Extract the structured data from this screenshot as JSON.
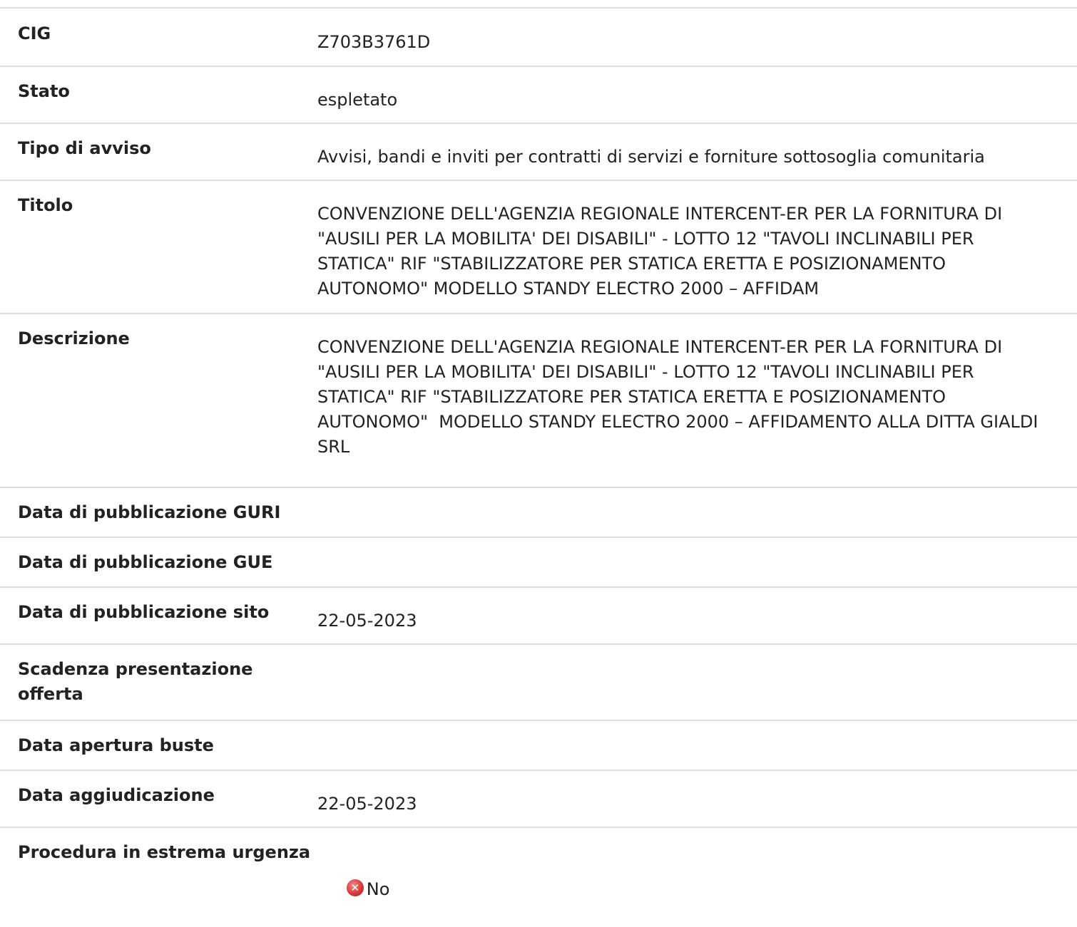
{
  "fields": {
    "cig": {
      "label": "CIG",
      "value": "Z703B3761D"
    },
    "stato": {
      "label": "Stato",
      "value": "espletato"
    },
    "tipo_avviso": {
      "label": "Tipo di avviso",
      "value": "Avvisi, bandi e inviti per contratti di servizi e forniture sottosoglia comunitaria"
    },
    "titolo": {
      "label": "Titolo",
      "value": "CONVENZIONE DELL'AGENZIA REGIONALE INTERCENT-ER PER LA FORNITURA DI \"AUSILI PER LA MOBILITA' DEI DISABILI\" - LOTTO 12 \"TAVOLI INCLINABILI PER STATICA\" RIF \"STABILIZZATORE PER STATICA ERETTA E POSIZIONAMENTO AUTONOMO\" MODELLO STANDY ELECTRO 2000 – AFFIDAM"
    },
    "descrizione": {
      "label": "Descrizione",
      "value": "CONVENZIONE DELL'AGENZIA REGIONALE INTERCENT-ER PER LA FORNITURA DI \"AUSILI PER LA MOBILITA' DEI DISABILI\" - LOTTO 12 \"TAVOLI INCLINABILI PER STATICA\" RIF \"STABILIZZATORE PER STATICA ERETTA E POSIZIONAMENTO AUTONOMO\"  MODELLO STANDY ELECTRO 2000 – AFFIDAMENTO ALLA DITTA GIALDI SRL"
    },
    "data_guri": {
      "label": "Data di pubblicazione GURI",
      "value": ""
    },
    "data_gue": {
      "label": "Data di pubblicazione GUE",
      "value": ""
    },
    "data_sito": {
      "label": "Data di pubblicazione sito",
      "value": "22-05-2023"
    },
    "scadenza": {
      "label": "Scadenza presentazione offerta",
      "value": ""
    },
    "apertura_buste": {
      "label": "Data apertura buste",
      "value": ""
    },
    "aggiudicazione": {
      "label": "Data aggiudicazione",
      "value": "22-05-2023"
    },
    "urgenza": {
      "label": "Procedura in estrema urgenza",
      "value": "No",
      "icon": "close-circle-icon",
      "icon_color": "#d63a3a"
    }
  }
}
